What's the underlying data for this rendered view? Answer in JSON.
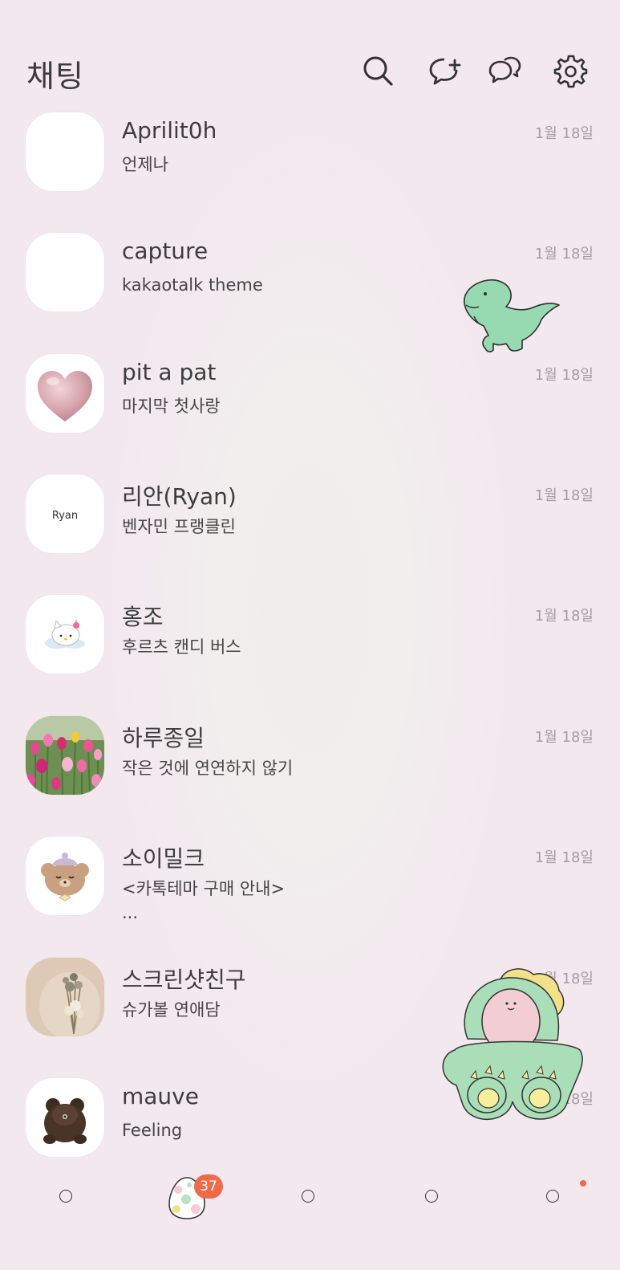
{
  "header": {
    "title": "채팅",
    "icons": [
      "search-icon",
      "new-chat-icon",
      "open-chat-icon",
      "settings-icon"
    ]
  },
  "chats": [
    {
      "name": "Aprilit0h",
      "message": "언제나",
      "time": "1월 18일",
      "avatar": "blank"
    },
    {
      "name": "capture",
      "message": "kakaotalk theme",
      "time": "1월 18일",
      "avatar": "blank"
    },
    {
      "name": "pit a pat",
      "message": "마지막 첫사랑",
      "time": "1월 18일",
      "avatar": "pink-heart"
    },
    {
      "name": "리안(Ryan)",
      "message": "벤자민 프랭클린",
      "time": "1월 18일",
      "avatar": "ryan-text",
      "avatar_text": "Ryan"
    },
    {
      "name": "홍조",
      "message": "후르츠 캔디 버스",
      "time": "1월 18일",
      "avatar": "hello-kitty"
    },
    {
      "name": "하루종일",
      "message": "작은 것에 연연하지 않기",
      "time": "1월 18일",
      "avatar": "tulips-photo"
    },
    {
      "name": "소이밀크",
      "message": "<카톡테마 구매 안내>\n...",
      "time": "1월 18일",
      "avatar": "teddy-bear"
    },
    {
      "name": "스크린샷친구",
      "message": "슈가볼 연애담",
      "time": "1월 18일",
      "avatar": "dried-flowers-photo"
    },
    {
      "name": "mauve",
      "message": "Feeling",
      "time": "1월 18일",
      "avatar": "brown-bear-plush"
    }
  ],
  "bottom_nav": {
    "badge_count": "37",
    "items": [
      "friends-tab",
      "chats-tab",
      "view-tab",
      "shopping-tab",
      "more-tab"
    ]
  },
  "colors": {
    "background": "#f3e8ee",
    "badge": "#ee6a4c",
    "time_text": "#a99aa2",
    "dino_green": "#97d9b0"
  }
}
